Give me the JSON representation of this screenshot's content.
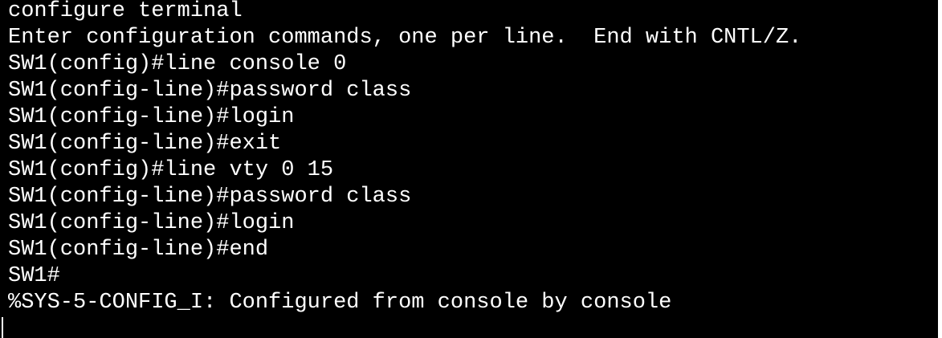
{
  "terminal": {
    "lines": [
      "configure terminal",
      "Enter configuration commands, one per line.  End with CNTL/Z.",
      "SW1(config)#line console 0",
      "SW1(config-line)#password class",
      "SW1(config-line)#login",
      "SW1(config-line)#exit",
      "SW1(config)#line vty 0 15",
      "SW1(config-line)#password class",
      "SW1(config-line)#login",
      "SW1(config-line)#end",
      "SW1#",
      "%SYS-5-CONFIG_I: Configured from console by console"
    ],
    "colors": {
      "background": "#000000",
      "foreground": "#ffffff"
    }
  }
}
